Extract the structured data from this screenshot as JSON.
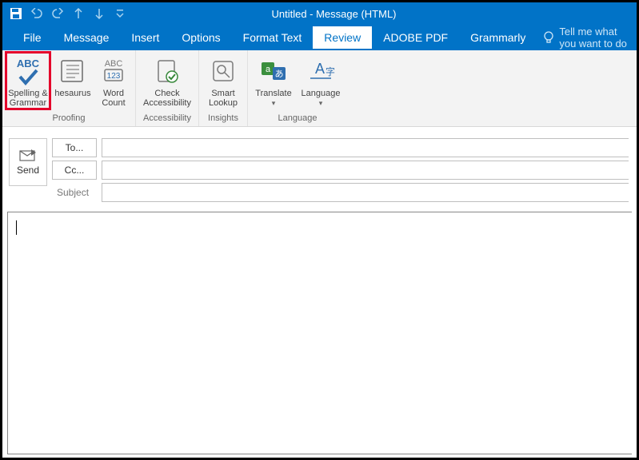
{
  "title": "Untitled  -  Message (HTML)",
  "qa": {
    "save": "save",
    "undo": "undo",
    "redo": "redo",
    "up": "up",
    "down": "down",
    "more": "more"
  },
  "menu": {
    "file": "File",
    "message": "Message",
    "insert": "Insert",
    "options": "Options",
    "format_text": "Format Text",
    "review": "Review",
    "adobe_pdf": "ADOBE PDF",
    "grammarly": "Grammarly",
    "tellme": "Tell me what you want to do"
  },
  "ribbon": {
    "spelling": {
      "abc": "ABC",
      "label": "Spelling & Grammar"
    },
    "thesaurus": {
      "label": "hesaurus"
    },
    "wordcount": {
      "abc": "ABC",
      "num": "123",
      "label": "Word Count"
    },
    "check_access": {
      "label": "Check Accessibility"
    },
    "smart_lookup": {
      "label": "Smart Lookup"
    },
    "translate": {
      "label": "Translate"
    },
    "language": {
      "label": "Language"
    },
    "groups": {
      "proofing": "Proofing",
      "accessibility": "Accessibility",
      "insights": "Insights",
      "language": "Language"
    }
  },
  "compose": {
    "send": "Send",
    "to": "To...",
    "cc": "Cc...",
    "subject": "Subject",
    "to_value": "",
    "cc_value": "",
    "subject_value": "",
    "body_value": ""
  }
}
